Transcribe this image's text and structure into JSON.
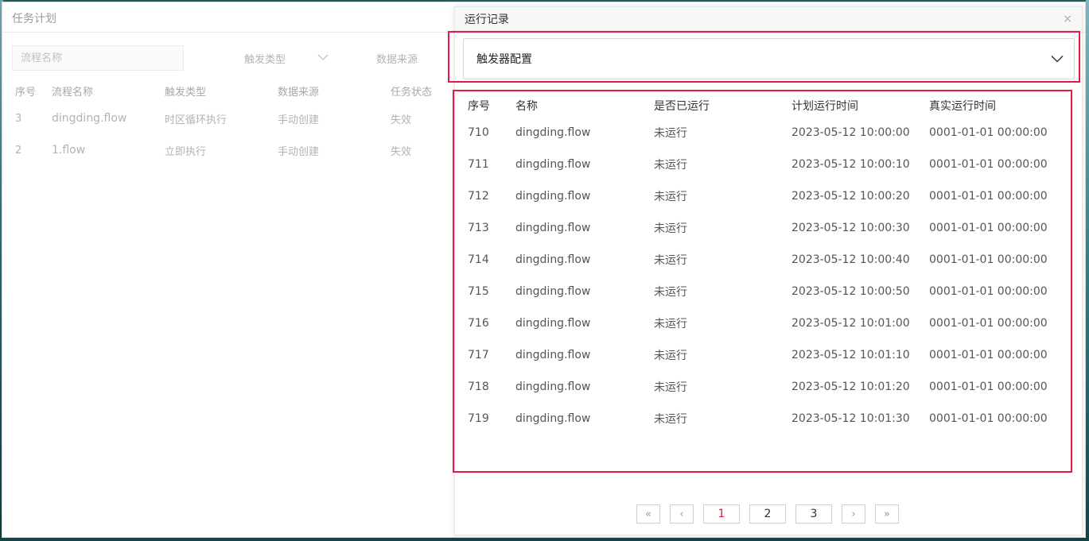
{
  "main": {
    "title": "任务计划",
    "search_placeholder": "流程名称",
    "trigger_filter_label": "触发类型",
    "source_filter_label": "数据来源",
    "columns": [
      "序号",
      "流程名称",
      "触发类型",
      "数据来源",
      "任务状态"
    ],
    "rows": [
      {
        "id": "3",
        "name": "dingding.flow",
        "trigger": "时区循环执行",
        "source": "手动创建",
        "status": "失效"
      },
      {
        "id": "2",
        "name": "1.flow",
        "trigger": "立即执行",
        "source": "手动创建",
        "status": "失效"
      }
    ]
  },
  "dialog": {
    "title": "运行记录",
    "close_label": "×",
    "accordion_label": "触发器配置",
    "columns": [
      "序号",
      "名称",
      "是否已运行",
      "计划运行时间",
      "真实运行时间"
    ],
    "rows": [
      {
        "id": "710",
        "name": "dingding.flow",
        "ran": "未运行",
        "planned": "2023-05-12 10:00:00",
        "actual": "0001-01-01 00:00:00"
      },
      {
        "id": "711",
        "name": "dingding.flow",
        "ran": "未运行",
        "planned": "2023-05-12 10:00:10",
        "actual": "0001-01-01 00:00:00"
      },
      {
        "id": "712",
        "name": "dingding.flow",
        "ran": "未运行",
        "planned": "2023-05-12 10:00:20",
        "actual": "0001-01-01 00:00:00"
      },
      {
        "id": "713",
        "name": "dingding.flow",
        "ran": "未运行",
        "planned": "2023-05-12 10:00:30",
        "actual": "0001-01-01 00:00:00"
      },
      {
        "id": "714",
        "name": "dingding.flow",
        "ran": "未运行",
        "planned": "2023-05-12 10:00:40",
        "actual": "0001-01-01 00:00:00"
      },
      {
        "id": "715",
        "name": "dingding.flow",
        "ran": "未运行",
        "planned": "2023-05-12 10:00:50",
        "actual": "0001-01-01 00:00:00"
      },
      {
        "id": "716",
        "name": "dingding.flow",
        "ran": "未运行",
        "planned": "2023-05-12 10:01:00",
        "actual": "0001-01-01 00:00:00"
      },
      {
        "id": "717",
        "name": "dingding.flow",
        "ran": "未运行",
        "planned": "2023-05-12 10:01:10",
        "actual": "0001-01-01 00:00:00"
      },
      {
        "id": "718",
        "name": "dingding.flow",
        "ran": "未运行",
        "planned": "2023-05-12 10:01:20",
        "actual": "0001-01-01 00:00:00"
      },
      {
        "id": "719",
        "name": "dingding.flow",
        "ran": "未运行",
        "planned": "2023-05-12 10:01:30",
        "actual": "0001-01-01 00:00:00"
      }
    ],
    "pagination": {
      "first_label": "«",
      "prev_label": "‹",
      "pages": [
        "1",
        "2",
        "3"
      ],
      "current_page": "1",
      "next_label": "›",
      "last_label": "»"
    }
  },
  "colors": {
    "highlight": "#e8174a",
    "active_page": "#e0183e"
  }
}
